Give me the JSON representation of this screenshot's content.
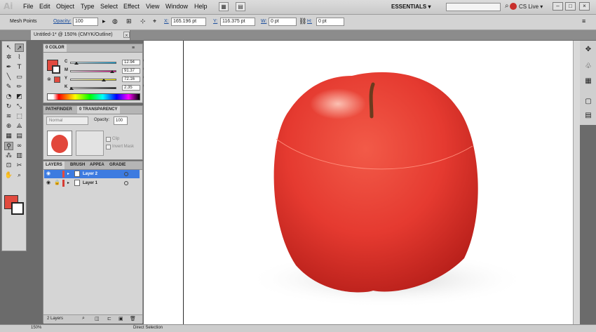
{
  "app": {
    "logo": "Ai"
  },
  "menu": [
    "File",
    "Edit",
    "Object",
    "Type",
    "Select",
    "Effect",
    "View",
    "Window",
    "Help"
  ],
  "workspace": {
    "label": "ESSENTIALS ▾"
  },
  "cslive": {
    "label": "CS Live ▾"
  },
  "controlbar": {
    "mode": "Mesh Points",
    "opacity_label": "Opacity:",
    "opacity_value": "100",
    "x_label": "X:",
    "x_value": "165.196 pt",
    "y_label": "Y:",
    "y_value": "116.375 pt",
    "w_label": "W:",
    "w_value": "0 pt",
    "h_label": "H:",
    "h_value": "0 pt"
  },
  "document": {
    "tab_title": "Untitled-1* @ 150% (CMYK/Outline)"
  },
  "color_panel": {
    "title": "0 COLOR",
    "channels": [
      {
        "letter": "C",
        "value": "12.94",
        "unit": "%",
        "fraction": 0.1294
      },
      {
        "letter": "M",
        "value": "91.37",
        "unit": "%",
        "fraction": 0.9137
      },
      {
        "letter": "Y",
        "value": "72.16",
        "unit": "%",
        "fraction": 0.7216
      },
      {
        "letter": "K",
        "value": "2.35",
        "unit": "%",
        "fraction": 0.0235
      }
    ],
    "fill_color": "#e14a3e"
  },
  "transparency_panel": {
    "tabs": [
      "PATHFINDER",
      "0 TRANSPARENCY"
    ],
    "blend_mode": "Normal",
    "opacity_label": "Opacity:",
    "opacity_value": "100",
    "clip_label": "Clip",
    "invert_mask_label": "Invert Mask"
  },
  "layers_panel": {
    "tabs": [
      "LAYERS",
      "BRUSH",
      "APPEA",
      "GRADIE"
    ],
    "layers": [
      {
        "name": "Layer 2",
        "color": "#e64a3c",
        "selected": true
      },
      {
        "name": "Layer 1",
        "color": "#d63b32",
        "selected": false
      }
    ],
    "count_label": "2 Layers"
  },
  "colors": {
    "apple": "#e53a30",
    "apple_dark": "#b71f1a",
    "selection": "#3d7be0"
  },
  "status": {
    "zoom": "150%",
    "tool": "Direct Selection"
  }
}
